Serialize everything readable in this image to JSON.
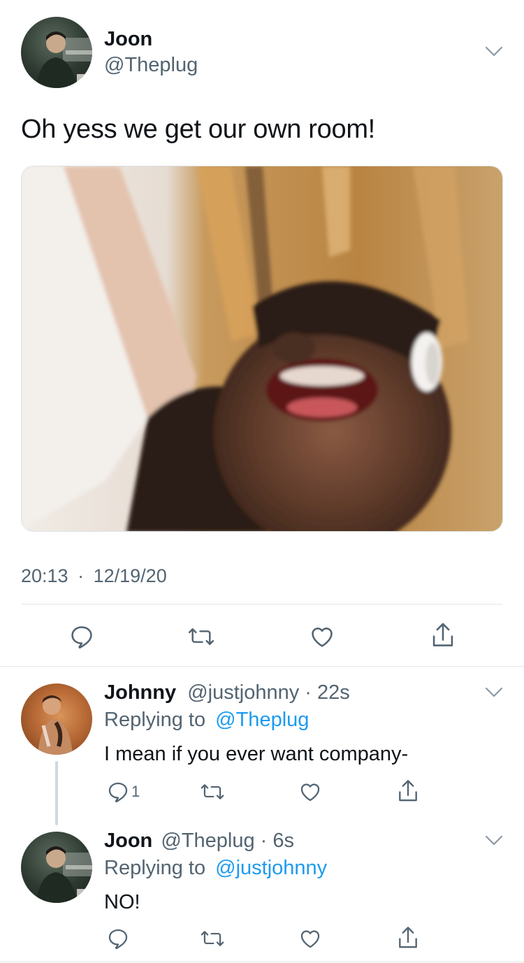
{
  "main_tweet": {
    "author_name": "Joon",
    "author_handle": "@Theplug",
    "text": "Oh yess we get our own room!",
    "image_alt": "crying-kid-with-headphones-meme",
    "time": "20:13",
    "date": "12/19/20",
    "separator": "·"
  },
  "replies": [
    {
      "author_name": "Johnny",
      "author_handle": "@justjohnny",
      "age": "22s",
      "replying_prefix": "Replying to",
      "replying_to": "@Theplug",
      "text": "I mean if you ever want company-",
      "reply_count": "1"
    },
    {
      "author_name": "Joon",
      "author_handle": "@Theplug",
      "age": "6s",
      "replying_prefix": "Replying to",
      "replying_to": "@justjohnny",
      "text": "NO!",
      "reply_count": ""
    }
  ],
  "colors": {
    "accent": "#1d9bf0",
    "secondary_text": "#536471",
    "divider": "#e6e6e6"
  },
  "icons": [
    "chevron-down-icon",
    "reply-icon",
    "retweet-icon",
    "like-icon",
    "share-icon"
  ]
}
